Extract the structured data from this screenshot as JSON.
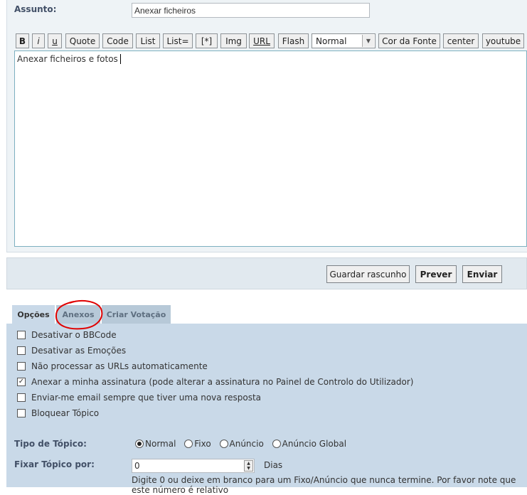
{
  "subject": {
    "label": "Assunto:",
    "value": "Anexar ficheiros"
  },
  "toolbar": {
    "buttons": [
      "B",
      "i",
      "u",
      "Quote",
      "Code",
      "List",
      "List=",
      "[*]",
      "Img",
      "URL",
      "Flash"
    ],
    "size_select": "Normal",
    "buttons2": [
      "Cor da Fonte",
      "center",
      "youtube"
    ]
  },
  "editor": {
    "text": "Anexar ficheiros e fotos"
  },
  "actions": {
    "draft": "Guardar rascunho",
    "preview": "Prever",
    "submit": "Enviar"
  },
  "tabs": [
    "Opções",
    "Anexos",
    "Criar Votação"
  ],
  "options": [
    {
      "label": "Desativar o BBCode",
      "checked": false
    },
    {
      "label": "Desativar as Emoções",
      "checked": false
    },
    {
      "label": "Não processar as URLs automaticamente",
      "checked": false
    },
    {
      "label": "Anexar a minha assinatura (pode alterar a assinatura no Painel de Controlo do Utilizador)",
      "checked": true
    },
    {
      "label": "Enviar-me email sempre que tiver uma nova resposta",
      "checked": false
    },
    {
      "label": "Bloquear Tópico",
      "checked": false
    }
  ],
  "topic_type": {
    "label": "Tipo de Tópico:",
    "options": [
      "Normal",
      "Fixo",
      "Anúncio",
      "Anúncio Global"
    ],
    "selected": "Normal"
  },
  "stick": {
    "label": "Fixar Tópico por:",
    "value": "0",
    "unit": "Dias",
    "hint": "Digite 0 ou deixe em branco para um Fixo/Anúncio que nunca termine. Por favor note que este número é relativo"
  },
  "colors": {
    "annotation": "#e00000"
  }
}
